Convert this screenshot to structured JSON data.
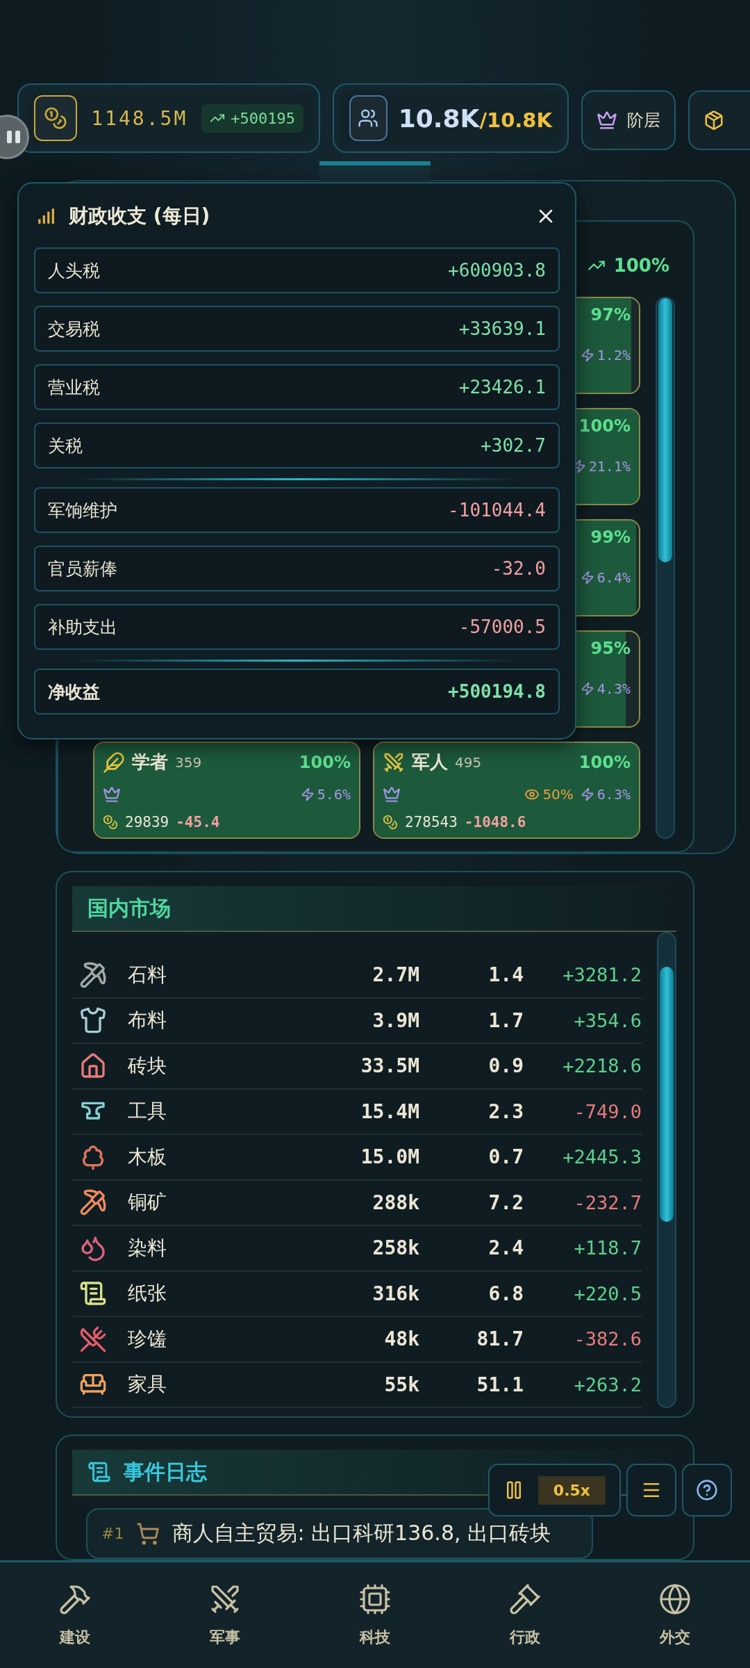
{
  "top_bar": {
    "treasury": {
      "value": "1148.5M",
      "delta": "+500195"
    },
    "population": {
      "current": "10.8K",
      "capacity": "/10.8K"
    },
    "buttons": [
      {
        "label": "阶层"
      }
    ]
  },
  "fiscal_popup": {
    "title": "财政收支 (每日)",
    "groups": [
      {
        "rows": [
          {
            "label": "人头税",
            "value": "+600903.8",
            "kind": "income"
          },
          {
            "label": "交易税",
            "value": "+33639.1",
            "kind": "income"
          },
          {
            "label": "营业税",
            "value": "+23426.1",
            "kind": "income"
          },
          {
            "label": "关税",
            "value": "+302.7",
            "kind": "income"
          }
        ]
      },
      {
        "rows": [
          {
            "label": "军饷维护",
            "value": "-101044.4",
            "kind": "expense"
          },
          {
            "label": "官员薪俸",
            "value": "-32.0",
            "kind": "expense"
          },
          {
            "label": "补助支出",
            "value": "-57000.5",
            "kind": "expense"
          }
        ]
      },
      {
        "rows": [
          {
            "label": "净收益",
            "value": "+500194.8",
            "kind": "total"
          }
        ]
      }
    ]
  },
  "social_classes": {
    "overall": "100%",
    "cards": [
      {
        "satisfaction": "97%",
        "level": 0.97,
        "bonus": "1.2%"
      },
      {
        "satisfaction": "100%",
        "level": 1,
        "bonus": "21.1%"
      },
      {
        "satisfaction": "99%",
        "level": 0.99,
        "bonus": "6.4%"
      },
      {
        "satisfaction": "95%",
        "level": 0.95,
        "bonus": "4.3%"
      },
      {
        "name": "学者",
        "count": "359",
        "satisfaction": "100%",
        "level": 1,
        "bonus": "5.6%",
        "wealth": "29839",
        "change": "-45.4"
      },
      {
        "name": "军人",
        "count": "495",
        "satisfaction": "100%",
        "level": 1,
        "influence": "50%",
        "bonus": "6.3%",
        "wealth": "278543",
        "change": "-1048.6"
      }
    ]
  },
  "market": {
    "title": "国内市场",
    "rows": [
      {
        "name": "石料",
        "stock": "2.7M",
        "price": "1.4",
        "change": "+3281.2",
        "kind": "gain",
        "color": "#a3aba9"
      },
      {
        "name": "布料",
        "stock": "3.9M",
        "price": "1.7",
        "change": "+354.6",
        "kind": "gain",
        "color": "#a9cdd6"
      },
      {
        "name": "砖块",
        "stock": "33.5M",
        "price": "0.9",
        "change": "+2218.6",
        "kind": "gain",
        "color": "#e77a7a"
      },
      {
        "name": "工具",
        "stock": "15.4M",
        "price": "2.3",
        "change": "-749.0",
        "kind": "loss",
        "color": "#86cfcf"
      },
      {
        "name": "木板",
        "stock": "15.0M",
        "price": "0.7",
        "change": "+2445.3",
        "kind": "gain",
        "color": "#e0735c"
      },
      {
        "name": "铜矿",
        "stock": "288k",
        "price": "7.2",
        "change": "-232.7",
        "kind": "loss",
        "color": "#f08a5d"
      },
      {
        "name": "染料",
        "stock": "258k",
        "price": "2.4",
        "change": "+118.7",
        "kind": "gain",
        "color": "#e0627a"
      },
      {
        "name": "纸张",
        "stock": "316k",
        "price": "6.8",
        "change": "+220.5",
        "kind": "gain",
        "color": "#d8e08a"
      },
      {
        "name": "珍馐",
        "stock": "48k",
        "price": "81.7",
        "change": "-382.6",
        "kind": "loss",
        "color": "#e85a6a"
      },
      {
        "name": "家具",
        "stock": "55k",
        "price": "51.1",
        "change": "+263.2",
        "kind": "gain",
        "color": "#f0a060"
      }
    ]
  },
  "event_log": {
    "title": "事件日志",
    "entries": [
      {
        "number": "#1",
        "text": "商人自主贸易: 出口科研136.8, 出口砖块"
      }
    ]
  },
  "game_controls": {
    "speed": "0.5x"
  },
  "bottom_nav": [
    {
      "label": "建设"
    },
    {
      "label": "军事"
    },
    {
      "label": "科技"
    },
    {
      "label": "行政"
    },
    {
      "label": "外交"
    }
  ]
}
